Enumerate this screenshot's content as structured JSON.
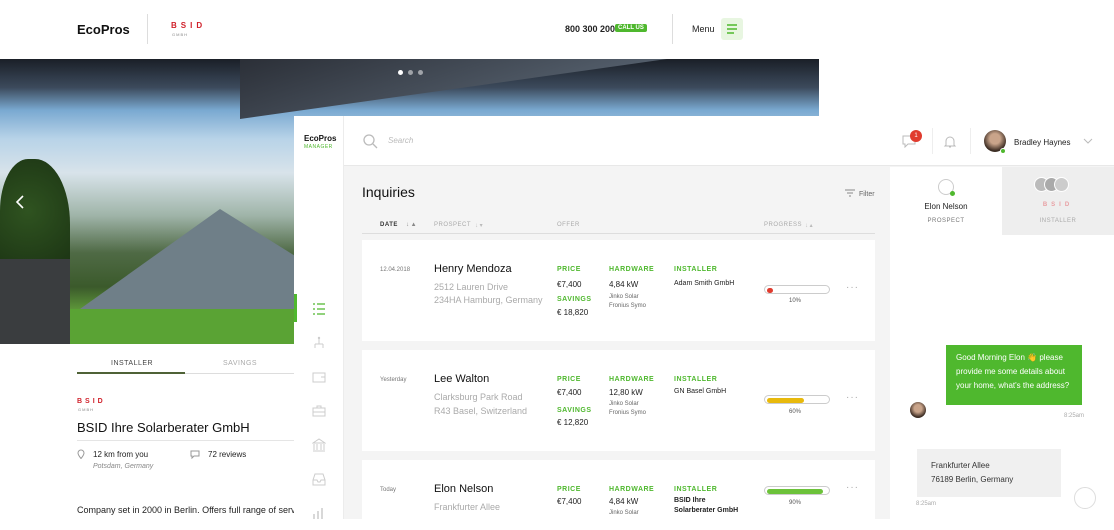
{
  "site": {
    "logo": "EcoPros",
    "partner_logo": "BSID",
    "partner_sub": "GMBH",
    "phone": "800 300 200",
    "call_badge": "CALL US",
    "menu_label": "Menu"
  },
  "profile": {
    "tabs": [
      "INSTALLER",
      "SAVINGS"
    ],
    "logo": "BSID",
    "logo_sub": "GMBH",
    "company": "BSID Ihre Solarberater GmbH",
    "distance": "12 km from you",
    "location": "Potsdam, Germany",
    "reviews": "72 reviews",
    "description": "Company set in 2000 in Berlin. Offers full range of serv"
  },
  "manager": {
    "brand": "EcoPros",
    "brand_sub": "MANAGER",
    "search_placeholder": "Search",
    "notification_count": "1",
    "user_name": "Bradley Haynes",
    "title": "Inquiries",
    "filter_label": "Filter",
    "columns": [
      "DATE",
      "PROSPECT",
      "OFFER",
      "PROGRESS"
    ],
    "labels": {
      "price": "PRICE",
      "savings": "SAVINGS",
      "hardware": "HARDWARE",
      "installer": "INSTALLER"
    },
    "rows": [
      {
        "date": "12.04.2018",
        "name": "Henry Mendoza",
        "addr1": "2512  Lauren Drive",
        "addr2": "234HA Hamburg, Germany",
        "price": "€7,400",
        "savings": "€ 18,820",
        "hw_kw": "4,84 kW",
        "hw1": "Jinko Solar",
        "hw2": "Fronius Symo",
        "installer": "Adam Smith GmbH",
        "progress": "10%",
        "progress_value": 0.1,
        "color": "#e03b2e"
      },
      {
        "date": "Yesterday",
        "name": "Lee Walton",
        "addr1": "Clarksburg Park Road",
        "addr2": "R43 Basel, Switzerland",
        "price": "€7,400",
        "savings": "€ 12,820",
        "hw_kw": "12,80 kW",
        "hw1": "Jinko Solar",
        "hw2": "Fronius Symo",
        "installer": "GN Basel GmbH",
        "progress": "60%",
        "progress_value": 0.6,
        "color": "#e8b90c"
      },
      {
        "date": "Today",
        "name": "Elon Nelson",
        "addr1": "Frankfurter Allee",
        "price": "€7,400",
        "hw_kw": "4,84 kW",
        "hw1": "Jinko Solar",
        "installer": "BSID Ihre Solarberater GmbH",
        "installer_l1": "BSID Ihre",
        "installer_l2": "Solarberater GmbH",
        "progress": "90%",
        "progress_value": 0.9,
        "color": "#6cc23a"
      }
    ]
  },
  "chat": {
    "prospect_name": "Elon Nelson",
    "prospect_tab": "PROSPECT",
    "installer_tab": "INSTALLER",
    "installer_logo": "BSID",
    "msg1": "Good Morning Elon 👋 please provide me some details about your home, what's the address?",
    "msg1_time": "8:25am",
    "msg2_l1": "Frankfurter Allee",
    "msg2_l2": "76189 Berlin, Germany",
    "msg2_time": "8:25am"
  },
  "colors": {
    "accent": "#4fb82e",
    "red": "#d0202a"
  }
}
